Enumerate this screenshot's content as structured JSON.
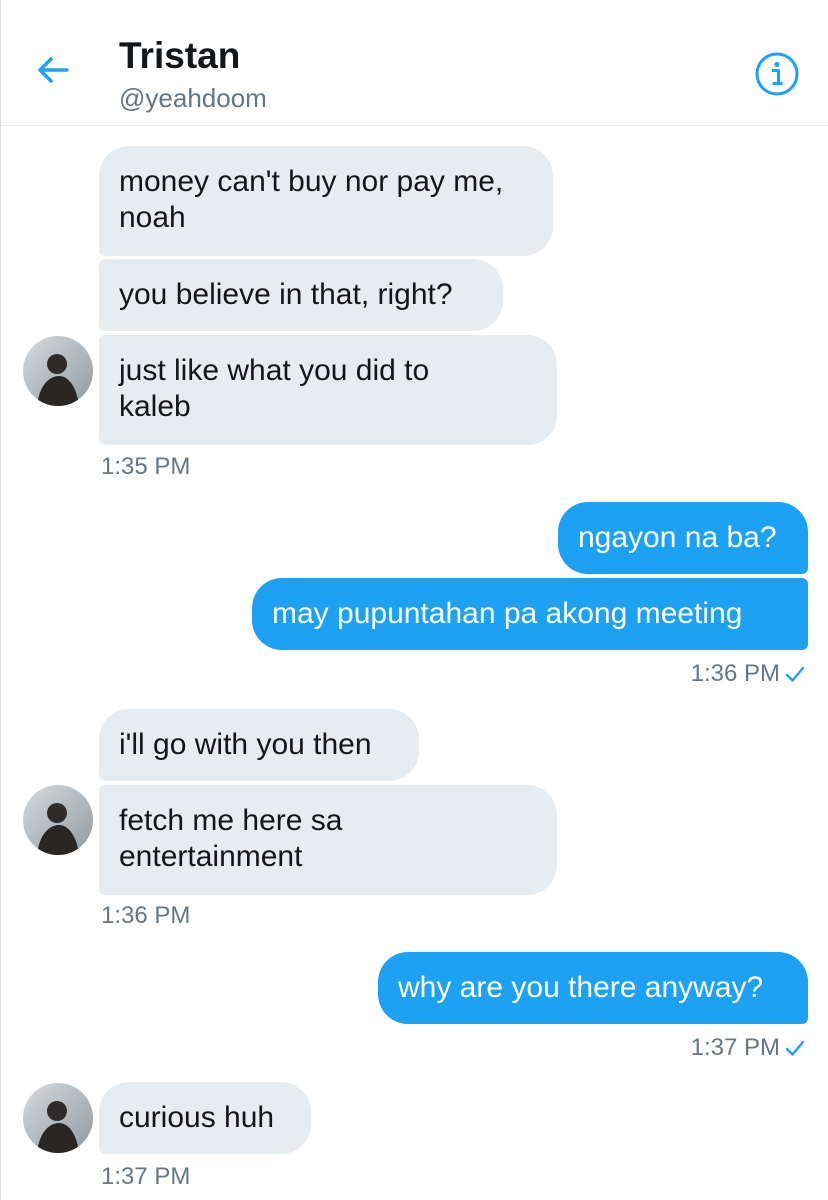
{
  "header": {
    "name": "Tristan",
    "handle": "@yeahdoom"
  },
  "colors": {
    "accent": "#1da1f2",
    "incoming_bubble": "#e6ecf0",
    "timestamp": "#657786"
  },
  "icons": {
    "back": "arrow-left-icon",
    "info": "info-icon",
    "read": "checkmark-icon"
  },
  "messages": [
    {
      "dir": "in",
      "text": "money can't buy nor pay me,\nnoah"
    },
    {
      "dir": "in",
      "text": "you believe in that, right?"
    },
    {
      "dir": "in",
      "text": "just like what you did to\nkaleb"
    },
    {
      "timestamp": "1:35 PM"
    },
    {
      "dir": "out",
      "text": "ngayon na ba?"
    },
    {
      "dir": "out",
      "text": "may pupuntahan pa akong meeting"
    },
    {
      "timestamp": "1:36 PM"
    },
    {
      "dir": "in",
      "text": "i'll go with you then"
    },
    {
      "dir": "in",
      "text": "fetch me here sa\nentertainment"
    },
    {
      "timestamp": "1:36 PM"
    },
    {
      "dir": "out",
      "text": "why are you there anyway?"
    },
    {
      "timestamp": "1:37 PM"
    },
    {
      "dir": "in",
      "text": "curious huh"
    },
    {
      "timestamp": "1:37 PM"
    }
  ]
}
